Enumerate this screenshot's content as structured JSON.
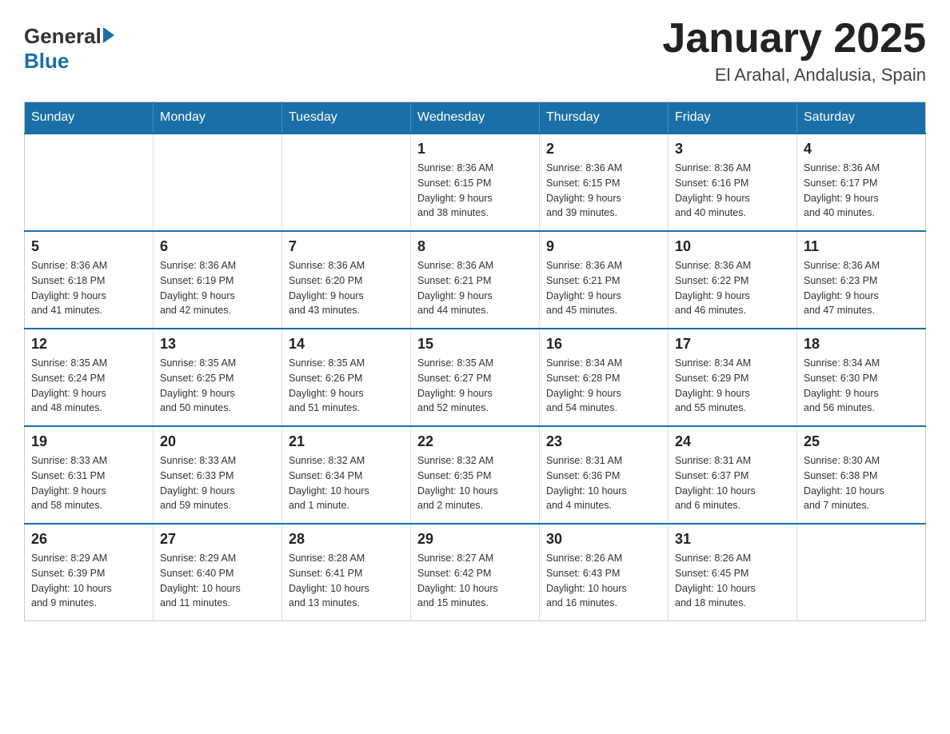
{
  "header": {
    "logo": {
      "general": "General",
      "blue": "Blue"
    },
    "title": "January 2025",
    "location": "El Arahal, Andalusia, Spain"
  },
  "weekdays": [
    "Sunday",
    "Monday",
    "Tuesday",
    "Wednesday",
    "Thursday",
    "Friday",
    "Saturday"
  ],
  "weeks": [
    [
      {
        "day": "",
        "info": ""
      },
      {
        "day": "",
        "info": ""
      },
      {
        "day": "",
        "info": ""
      },
      {
        "day": "1",
        "info": "Sunrise: 8:36 AM\nSunset: 6:15 PM\nDaylight: 9 hours\nand 38 minutes."
      },
      {
        "day": "2",
        "info": "Sunrise: 8:36 AM\nSunset: 6:15 PM\nDaylight: 9 hours\nand 39 minutes."
      },
      {
        "day": "3",
        "info": "Sunrise: 8:36 AM\nSunset: 6:16 PM\nDaylight: 9 hours\nand 40 minutes."
      },
      {
        "day": "4",
        "info": "Sunrise: 8:36 AM\nSunset: 6:17 PM\nDaylight: 9 hours\nand 40 minutes."
      }
    ],
    [
      {
        "day": "5",
        "info": "Sunrise: 8:36 AM\nSunset: 6:18 PM\nDaylight: 9 hours\nand 41 minutes."
      },
      {
        "day": "6",
        "info": "Sunrise: 8:36 AM\nSunset: 6:19 PM\nDaylight: 9 hours\nand 42 minutes."
      },
      {
        "day": "7",
        "info": "Sunrise: 8:36 AM\nSunset: 6:20 PM\nDaylight: 9 hours\nand 43 minutes."
      },
      {
        "day": "8",
        "info": "Sunrise: 8:36 AM\nSunset: 6:21 PM\nDaylight: 9 hours\nand 44 minutes."
      },
      {
        "day": "9",
        "info": "Sunrise: 8:36 AM\nSunset: 6:21 PM\nDaylight: 9 hours\nand 45 minutes."
      },
      {
        "day": "10",
        "info": "Sunrise: 8:36 AM\nSunset: 6:22 PM\nDaylight: 9 hours\nand 46 minutes."
      },
      {
        "day": "11",
        "info": "Sunrise: 8:36 AM\nSunset: 6:23 PM\nDaylight: 9 hours\nand 47 minutes."
      }
    ],
    [
      {
        "day": "12",
        "info": "Sunrise: 8:35 AM\nSunset: 6:24 PM\nDaylight: 9 hours\nand 48 minutes."
      },
      {
        "day": "13",
        "info": "Sunrise: 8:35 AM\nSunset: 6:25 PM\nDaylight: 9 hours\nand 50 minutes."
      },
      {
        "day": "14",
        "info": "Sunrise: 8:35 AM\nSunset: 6:26 PM\nDaylight: 9 hours\nand 51 minutes."
      },
      {
        "day": "15",
        "info": "Sunrise: 8:35 AM\nSunset: 6:27 PM\nDaylight: 9 hours\nand 52 minutes."
      },
      {
        "day": "16",
        "info": "Sunrise: 8:34 AM\nSunset: 6:28 PM\nDaylight: 9 hours\nand 54 minutes."
      },
      {
        "day": "17",
        "info": "Sunrise: 8:34 AM\nSunset: 6:29 PM\nDaylight: 9 hours\nand 55 minutes."
      },
      {
        "day": "18",
        "info": "Sunrise: 8:34 AM\nSunset: 6:30 PM\nDaylight: 9 hours\nand 56 minutes."
      }
    ],
    [
      {
        "day": "19",
        "info": "Sunrise: 8:33 AM\nSunset: 6:31 PM\nDaylight: 9 hours\nand 58 minutes."
      },
      {
        "day": "20",
        "info": "Sunrise: 8:33 AM\nSunset: 6:33 PM\nDaylight: 9 hours\nand 59 minutes."
      },
      {
        "day": "21",
        "info": "Sunrise: 8:32 AM\nSunset: 6:34 PM\nDaylight: 10 hours\nand 1 minute."
      },
      {
        "day": "22",
        "info": "Sunrise: 8:32 AM\nSunset: 6:35 PM\nDaylight: 10 hours\nand 2 minutes."
      },
      {
        "day": "23",
        "info": "Sunrise: 8:31 AM\nSunset: 6:36 PM\nDaylight: 10 hours\nand 4 minutes."
      },
      {
        "day": "24",
        "info": "Sunrise: 8:31 AM\nSunset: 6:37 PM\nDaylight: 10 hours\nand 6 minutes."
      },
      {
        "day": "25",
        "info": "Sunrise: 8:30 AM\nSunset: 6:38 PM\nDaylight: 10 hours\nand 7 minutes."
      }
    ],
    [
      {
        "day": "26",
        "info": "Sunrise: 8:29 AM\nSunset: 6:39 PM\nDaylight: 10 hours\nand 9 minutes."
      },
      {
        "day": "27",
        "info": "Sunrise: 8:29 AM\nSunset: 6:40 PM\nDaylight: 10 hours\nand 11 minutes."
      },
      {
        "day": "28",
        "info": "Sunrise: 8:28 AM\nSunset: 6:41 PM\nDaylight: 10 hours\nand 13 minutes."
      },
      {
        "day": "29",
        "info": "Sunrise: 8:27 AM\nSunset: 6:42 PM\nDaylight: 10 hours\nand 15 minutes."
      },
      {
        "day": "30",
        "info": "Sunrise: 8:26 AM\nSunset: 6:43 PM\nDaylight: 10 hours\nand 16 minutes."
      },
      {
        "day": "31",
        "info": "Sunrise: 8:26 AM\nSunset: 6:45 PM\nDaylight: 10 hours\nand 18 minutes."
      },
      {
        "day": "",
        "info": ""
      }
    ]
  ]
}
